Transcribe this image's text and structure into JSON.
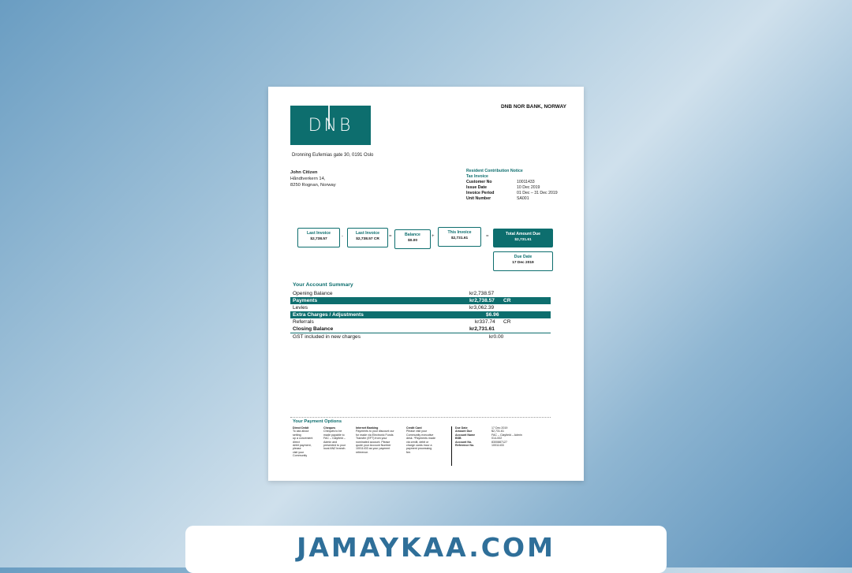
{
  "bank": {
    "logo_text": "DNB",
    "name": "DNB NOR BANK, NORWAY",
    "address": "Dronning Eufemias gate 30, 0191 Oslo"
  },
  "recipient": {
    "name": "John Citizen",
    "line1": "Håndtverkern 14,",
    "line2": "8250 Rognan, Norway"
  },
  "notice": {
    "title": "Resident Contribution Notice",
    "subtitle": "Tax Invoice",
    "fields": [
      {
        "k": "Customer No",
        "v": "10011433"
      },
      {
        "k": "Issue Date",
        "v": "10 Dec 2019"
      },
      {
        "k": "Invoice Period",
        "v": "01 Dec – 31 Dec 2019"
      },
      {
        "k": "Unit Number",
        "v": "SA001"
      }
    ]
  },
  "flow": {
    "last_invoice_label": "Last Invoice",
    "last_invoice_value": "$2,738.57",
    "minus": "-",
    "last_invoice2_label": "Last Invoice",
    "last_invoice2_value": "$2,738.57 CR",
    "eq1": "=",
    "balance_label": "Balance",
    "balance_value": "$0.00",
    "plus": "+",
    "this_invoice_label": "This Invoice",
    "this_invoice_value": "$2,731.61",
    "eq2": "=",
    "total_label": "Total Amount Due",
    "total_value": "$2,731.61",
    "due_label": "Due Date",
    "due_value": "17 Dec 2019"
  },
  "summary": {
    "title": "Your Account Summary",
    "rows": [
      {
        "label": "Opening Balance",
        "amount": "kr2,738.57",
        "suffix": ""
      },
      {
        "label": "Payments",
        "amount": "kr2,738.57",
        "suffix": "CR"
      },
      {
        "label": "Levies",
        "amount": "kr3,062.39",
        "suffix": ""
      },
      {
        "label": "Extra Charges / Adjustments",
        "amount": "$6.96",
        "suffix": ""
      },
      {
        "label": "Referrals",
        "amount": "kr337.74",
        "suffix": "CR"
      },
      {
        "label": "Closing Balance",
        "amount": "kr2,731.61",
        "suffix": ""
      },
      {
        "label": "GST included in new charges",
        "amount": "kr0.00",
        "suffix": ""
      }
    ]
  },
  "payment": {
    "title": "Your Payment Options",
    "direct_debit": {
      "h": "Direct Debit",
      "lines": [
        "To ask about",
        "setting",
        "up a convenient",
        "direct",
        "debit payment,",
        "please",
        "visit your",
        "Community"
      ]
    },
    "cheques": {
      "h": "Cheques",
      "lines": [
        "Cheques to be",
        "made payable to",
        "FAC – Clayfield –",
        "Admin and",
        "presented to your",
        "local ANZ branch."
      ]
    },
    "internet": {
      "h": "Internet Banking",
      "lines": [
        "Payments to your discount our",
        "for made via Electronic Funds",
        "Transfer (EFT) from your",
        "nominated account. Please",
        "quote your Account Number",
        "10011433 as your payment",
        "reference."
      ]
    },
    "credit": {
      "h": "Credit Card",
      "lines": [
        "Please visit your",
        "Community executive",
        "desk. *Payments made",
        "via credit, debit or",
        "charge cards incur a",
        "payment processing",
        "fee."
      ]
    },
    "details": [
      {
        "k": "Due Date",
        "v": "17 Dec 2019"
      },
      {
        "k": "Amount Due",
        "v": "$2,731.61"
      },
      {
        "k": "Account Name",
        "v": "FAC – Clayfield – Admin"
      },
      {
        "k": "BSB",
        "v": "014-002"
      },
      {
        "k": "Account No.",
        "v": "8300887127"
      },
      {
        "k": "Reference No.",
        "v": "10011433"
      }
    ]
  },
  "watermark": "JAMAYKAA.COM",
  "colors": {
    "accent": "#0d6e6e",
    "banner_text": "#2f6f99"
  }
}
